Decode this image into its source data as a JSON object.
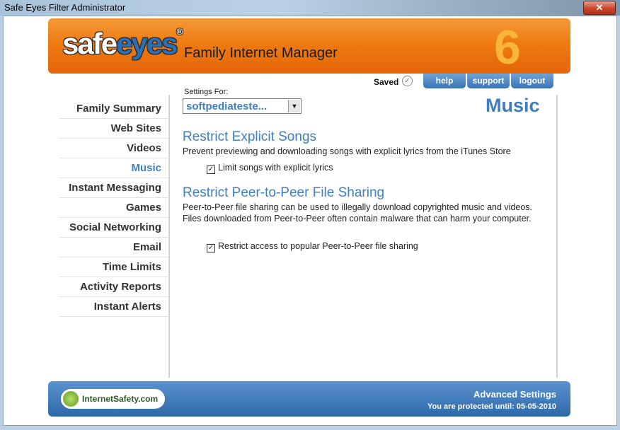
{
  "window": {
    "title": "Safe Eyes Filter Administrator",
    "close_glyph": "✕"
  },
  "header": {
    "logo_white": "safe",
    "logo_blue": "eyes",
    "registered": "®",
    "tagline": "Family Internet Manager",
    "version": "6"
  },
  "topnav": {
    "saved_label": "Saved",
    "saved_icon": "✓",
    "help": "help",
    "support": "support",
    "logout": "logout"
  },
  "sidebar": {
    "items": [
      "Family Summary",
      "Web Sites",
      "Videos",
      "Music",
      "Instant Messaging",
      "Games",
      "Social Networking",
      "Email",
      "Time Limits",
      "Activity Reports",
      "Instant Alerts"
    ],
    "active": "Music"
  },
  "main": {
    "settings_for_label": "Settings For:",
    "selected_user": "softpediateste...",
    "dropdown_arrow": "▼",
    "page_title": "Music",
    "sections": [
      {
        "title": "Restrict Explicit Songs",
        "description": "Prevent previewing and downloading songs with explicit lyrics from the iTunes Store",
        "checkbox_label": "Limit songs with explicit lyrics",
        "checked": true
      },
      {
        "title": "Restrict Peer-to-Peer File Sharing",
        "description": "Peer-to-Peer file sharing can be used to illegally download copyrighted music and videos. Files downloaded from Peer-to-Peer often contain malware that can harm your computer.",
        "checkbox_label": "Restrict access to popular Peer-to-Peer file sharing",
        "checked": true
      }
    ],
    "check_glyph": "✓"
  },
  "footer": {
    "partner_logo": "InternetSafety.com",
    "advanced_settings": "Advanced Settings",
    "protected_until": "You are protected until: 05-05-2010"
  },
  "colors": {
    "accent": "#3f7fbf",
    "header_orange": "#ee7b10",
    "footer_blue": "#2d68a9"
  }
}
